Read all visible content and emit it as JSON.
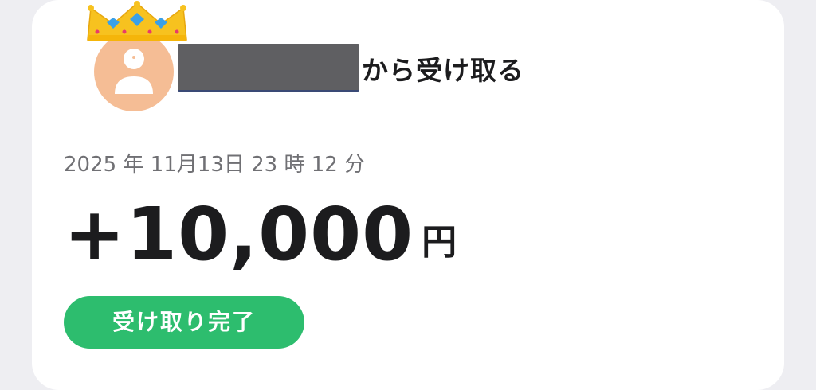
{
  "transaction": {
    "sender_suffix": "から受け取る",
    "datetime": "2025 年 11月13日 23 時 12 分",
    "amount": "+10,000",
    "currency": "円",
    "status": "受け取り完了"
  },
  "icons": {
    "avatar": "default-user-icon",
    "badge": "crown-icon"
  },
  "colors": {
    "status_green": "#2dbd6e",
    "avatar_bg": "#f5bd95",
    "crown_gold": "#f7c21f",
    "gem_blue": "#3aa0e8"
  }
}
